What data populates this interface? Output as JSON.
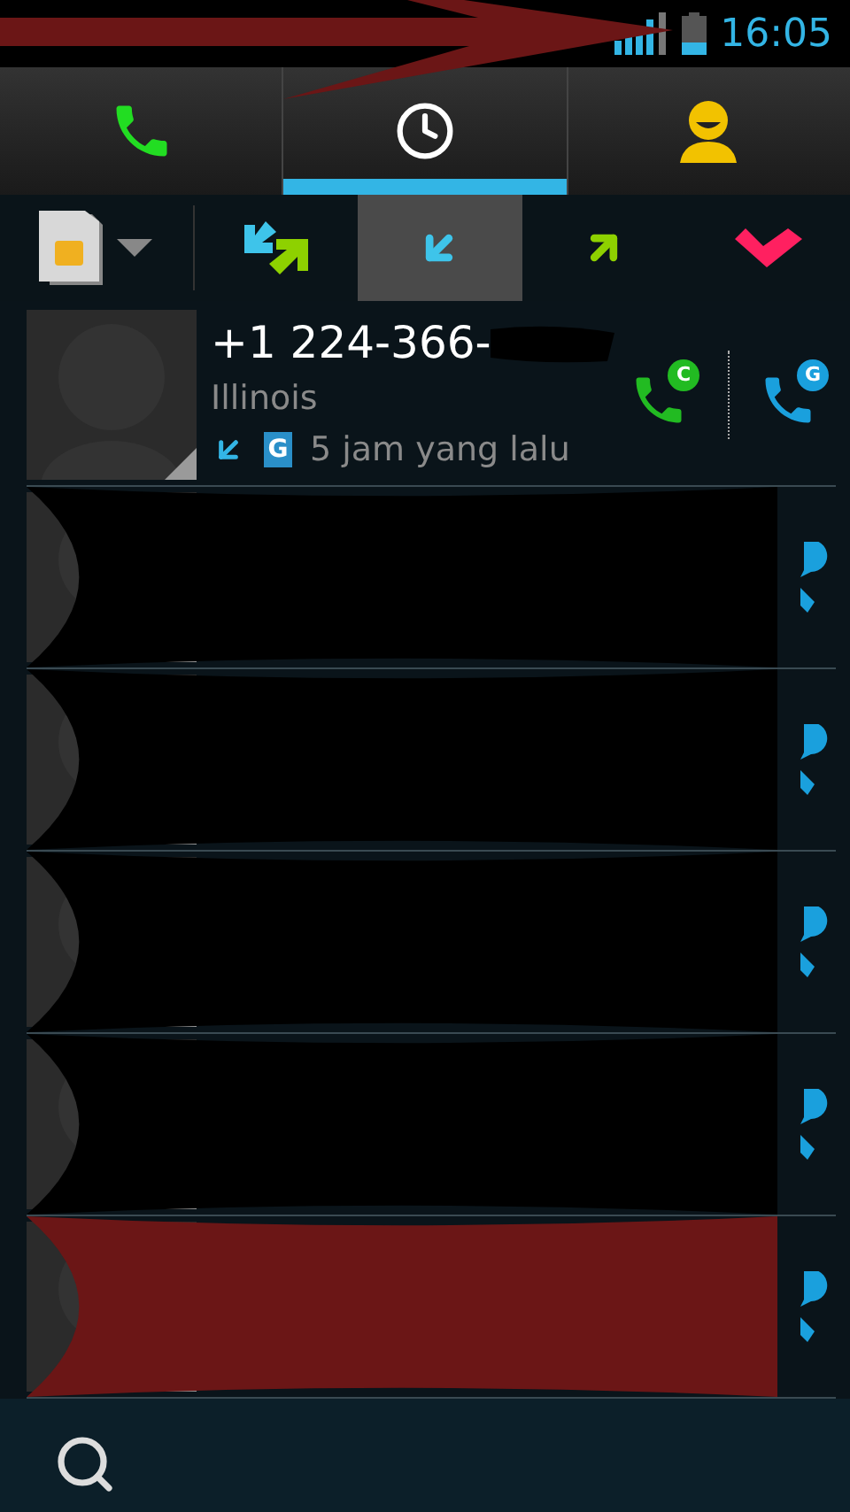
{
  "status_bar": {
    "time": "16:05"
  },
  "main_tabs": [
    {
      "kind": "dialer",
      "selected": false
    },
    {
      "kind": "recent",
      "selected": true
    },
    {
      "kind": "contacts",
      "selected": false
    }
  ],
  "filters": [
    {
      "kind": "all",
      "selected": false
    },
    {
      "kind": "incoming",
      "selected": true
    },
    {
      "kind": "outgoing",
      "selected": false
    },
    {
      "kind": "missed",
      "selected": false
    }
  ],
  "calls": [
    {
      "kind": "entry",
      "number": "+1 224-366-",
      "number_scribbled": true,
      "location": "Illinois",
      "account_badge": "G",
      "time": "5 jam yang lalu",
      "actions": [
        {
          "badge": "C",
          "color": "#22bb22"
        },
        {
          "badge": "G",
          "color": "#1aa0dd"
        }
      ]
    },
    {
      "kind": "redacted",
      "color": "#000000"
    },
    {
      "kind": "redacted",
      "color": "#000000"
    },
    {
      "kind": "redacted",
      "color": "#000000"
    },
    {
      "kind": "redacted",
      "color": "#000000"
    },
    {
      "kind": "redacted",
      "color": "#6b1616"
    }
  ]
}
